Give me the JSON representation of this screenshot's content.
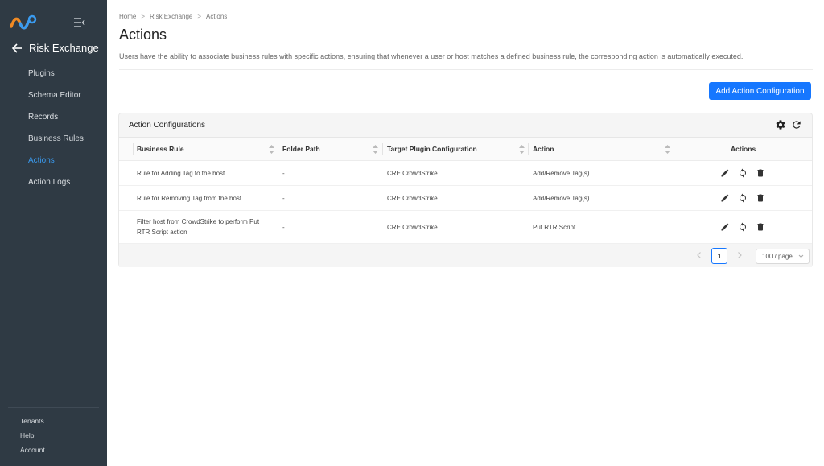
{
  "sidebar": {
    "back_title": "Risk Exchange",
    "items": [
      {
        "label": "Plugins"
      },
      {
        "label": "Schema Editor"
      },
      {
        "label": "Records"
      },
      {
        "label": "Business Rules"
      },
      {
        "label": "Actions",
        "active": true
      },
      {
        "label": "Action Logs"
      }
    ],
    "footer": [
      {
        "label": "Tenants"
      },
      {
        "label": "Help"
      },
      {
        "label": "Account"
      }
    ],
    "icons": {
      "logo": "brand-logo",
      "collapse": "menu-collapse-icon",
      "back": "arrow-left-icon"
    }
  },
  "breadcrumb": [
    "Home",
    "Risk Exchange",
    "Actions"
  ],
  "breadcrumb_separator": ">",
  "page": {
    "title": "Actions",
    "description": "Users have the ability to associate business rules with specific actions, ensuring that whenever a user or host matches a defined business rule, the corresponding action is automatically executed.",
    "add_button": "Add Action Configuration"
  },
  "card": {
    "title": "Action Configurations",
    "columns": [
      "Business Rule",
      "Folder Path",
      "Target Plugin Configuration",
      "Action",
      "Actions"
    ],
    "rows": [
      {
        "business_rule": "Rule for Adding Tag to the host",
        "folder_path": "-",
        "target": "CRE CrowdStrike",
        "action": "Add/Remove Tag(s)"
      },
      {
        "business_rule": "Rule for Removing Tag from the host",
        "folder_path": "-",
        "target": "CRE CrowdStrike",
        "action": "Add/Remove Tag(s)"
      },
      {
        "business_rule": "Filter host from CrowdStrike to perform Put RTR Script action",
        "folder_path": "-",
        "target": "CRE CrowdStrike",
        "action": "Put RTR Script"
      }
    ],
    "pagination": {
      "current_page": "1",
      "page_size": "100 / page"
    }
  },
  "colors": {
    "sidebar_bg": "#2f3a44",
    "accent": "#1677ff",
    "active_nav": "#3a9bf0"
  }
}
